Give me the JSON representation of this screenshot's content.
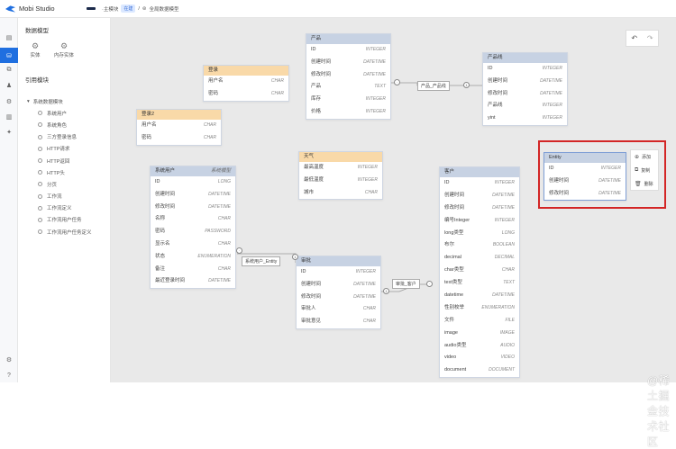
{
  "app": {
    "title": "Mobi Studio"
  },
  "breadcrumb": {
    "module": "·主模块",
    "tag": "在建",
    "sep": "/",
    "page": "全局数据模型"
  },
  "panel": {
    "title": "数据模型",
    "btn_entity": "实体",
    "btn_mem": "内存实体",
    "ref_title": "引用模块",
    "group": "系统数据模块",
    "items": [
      "系统用户",
      "系统角色",
      "三方登录信息",
      "HTTP请求",
      "HTTP返回",
      "HTTP头",
      "分页",
      "工作流",
      "工作流定义",
      "工作流用户任务",
      "工作流用户任务定义"
    ]
  },
  "icons": {
    "rail": [
      "page-icon",
      "model-icon",
      "component-icon",
      "user-icon",
      "plugin-icon",
      "file-icon",
      "settings-icon",
      "gear-icon",
      "help-icon"
    ]
  },
  "toolbar": {
    "undo": "↶",
    "redo": "↷"
  },
  "entities": {
    "product": {
      "name": "产品",
      "fields": [
        [
          "ID",
          "INTEGER"
        ],
        [
          "创建时间",
          "DATETIME"
        ],
        [
          "修改时间",
          "DATETIME"
        ],
        [
          "产品",
          "TEXT"
        ],
        [
          "库存",
          "INTEGER"
        ],
        [
          "价格",
          "INTEGER"
        ]
      ]
    },
    "productline": {
      "name": "产品线",
      "fields": [
        [
          "ID",
          "INTEGER"
        ],
        [
          "创建时间",
          "DATETIME"
        ],
        [
          "修改时间",
          "DATETIME"
        ],
        [
          "产品线",
          "INTEGER"
        ],
        [
          "yint",
          "INTEGER"
        ]
      ]
    },
    "login": {
      "name": "登录",
      "fields": [
        [
          "用户名",
          "CHAR"
        ],
        [
          "密码",
          "CHAR"
        ]
      ]
    },
    "login2": {
      "name": "登录2",
      "fields": [
        [
          "用户名",
          "CHAR"
        ],
        [
          "密码",
          "CHAR"
        ]
      ]
    },
    "sysuser": {
      "name": "系统用户",
      "tag": "系统模型",
      "fields": [
        [
          "ID",
          "LONG"
        ],
        [
          "创建时间",
          "DATETIME"
        ],
        [
          "修改时间",
          "DATETIME"
        ],
        [
          "名称",
          "CHAR"
        ],
        [
          "密码",
          "PASSWORD"
        ],
        [
          "显示名",
          "CHAR"
        ],
        [
          "状态",
          "ENUMERATION"
        ],
        [
          "备注",
          "CHAR"
        ],
        [
          "最近登录时间",
          "DATETIME"
        ]
      ]
    },
    "weather": {
      "name": "天气",
      "fields": [
        [
          "最高温度",
          "INTEGER"
        ],
        [
          "最低温度",
          "INTEGER"
        ],
        [
          "城市",
          "CHAR"
        ]
      ]
    },
    "approval": {
      "name": "审批",
      "fields": [
        [
          "ID",
          "INTEGER"
        ],
        [
          "创建时间",
          "DATETIME"
        ],
        [
          "修改时间",
          "DATETIME"
        ],
        [
          "审批人",
          "CHAR"
        ],
        [
          "审批意见",
          "CHAR"
        ]
      ]
    },
    "customer": {
      "name": "客户",
      "fields": [
        [
          "ID",
          "INTEGER"
        ],
        [
          "创建时间",
          "DATETIME"
        ],
        [
          "修改时间",
          "DATETIME"
        ],
        [
          "编号Integer",
          "INTEGER"
        ],
        [
          "long类型",
          "LONG"
        ],
        [
          "布尔",
          "BOOLEAN"
        ],
        [
          "decimal",
          "DECIMAL"
        ],
        [
          "char类型",
          "CHAR"
        ],
        [
          "text类型",
          "TEXT"
        ],
        [
          "datetime",
          "DATETIME"
        ],
        [
          "性别枚举",
          "ENUMERATION"
        ],
        [
          "文件",
          "FILE"
        ],
        [
          "image",
          "IMAGE"
        ],
        [
          "audio类型",
          "AUDIO"
        ],
        [
          "video",
          "VIDEO"
        ],
        [
          "document",
          "DOCUMENT"
        ]
      ]
    },
    "entity": {
      "name": "Entity",
      "fields": [
        [
          "ID",
          "INTEGER"
        ],
        [
          "创建时间",
          "DATETIME"
        ],
        [
          "修改时间",
          "DATETIME"
        ]
      ]
    }
  },
  "links": {
    "l1": "产品_产品线",
    "l2": "系统用户_Entity",
    "l3": "审批_客户"
  },
  "ctx": {
    "add": "添加",
    "copy": "复制",
    "del": "删除"
  },
  "watermark": "@稀土掘金技术社区"
}
